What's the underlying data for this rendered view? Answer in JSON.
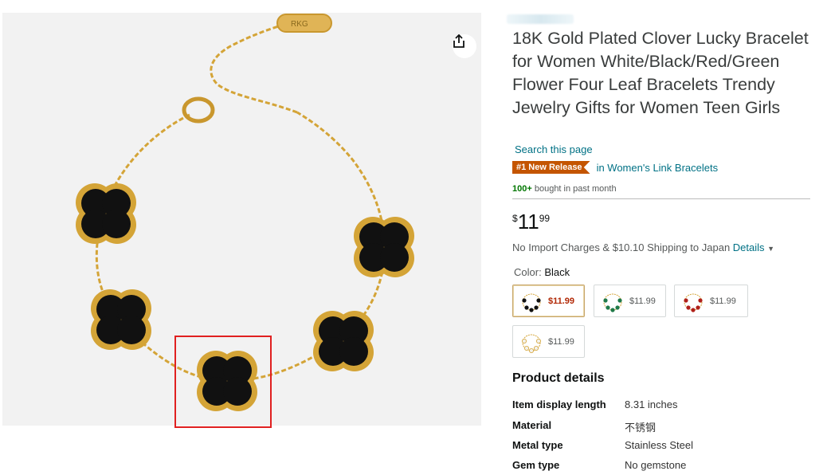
{
  "product": {
    "title": "18K Gold Plated Clover Lucky Bracelet for Women White/Black/Red/Green Flower Four Leaf Bracelets Trendy Jewelry Gifts for Women Teen Girls",
    "search_link": "Search this page",
    "badge": "#1 New Release",
    "badge_category": "in Women's Link Bracelets",
    "bought_count": "100+",
    "bought_text": "bought in past month",
    "price_symbol": "$",
    "price_whole": "11",
    "price_fraction": "99",
    "shipping_text": "No Import Charges & $10.10 Shipping to Japan",
    "shipping_details": "Details",
    "color_label": "Color:",
    "color_value": "Black",
    "clasp_text": "RKG",
    "swatches": [
      {
        "color": "#111111",
        "price": "$11.99",
        "selected": true
      },
      {
        "color": "#1f7a4a",
        "price": "$11.99",
        "selected": false
      },
      {
        "color": "#b0201a",
        "price": "$11.99",
        "selected": false
      },
      {
        "color": "#f3f1ea",
        "price": "$11.99",
        "selected": false
      }
    ]
  },
  "details": {
    "heading": "Product details",
    "rows": [
      {
        "key": "Item display length",
        "value": "8.31 inches"
      },
      {
        "key": "Material",
        "value": "不锈钢"
      },
      {
        "key": "Metal type",
        "value": "Stainless Steel"
      },
      {
        "key": "Gem type",
        "value": "No gemstone"
      }
    ]
  },
  "colors": {
    "link": "#007185",
    "badge": "#c45500",
    "price_red": "#b12704",
    "highlight_box": "#e02020",
    "gold": "#d4a437",
    "onyx": "#111111"
  }
}
